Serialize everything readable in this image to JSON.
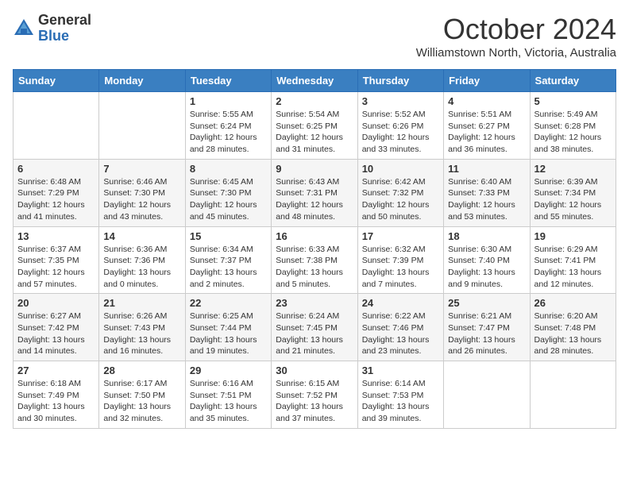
{
  "logo": {
    "general": "General",
    "blue": "Blue"
  },
  "header": {
    "month": "October 2024",
    "location": "Williamstown North, Victoria, Australia"
  },
  "weekdays": [
    "Sunday",
    "Monday",
    "Tuesday",
    "Wednesday",
    "Thursday",
    "Friday",
    "Saturday"
  ],
  "weeks": [
    [
      {
        "day": "",
        "info": ""
      },
      {
        "day": "",
        "info": ""
      },
      {
        "day": "1",
        "info": "Sunrise: 5:55 AM\nSunset: 6:24 PM\nDaylight: 12 hours and 28 minutes."
      },
      {
        "day": "2",
        "info": "Sunrise: 5:54 AM\nSunset: 6:25 PM\nDaylight: 12 hours and 31 minutes."
      },
      {
        "day": "3",
        "info": "Sunrise: 5:52 AM\nSunset: 6:26 PM\nDaylight: 12 hours and 33 minutes."
      },
      {
        "day": "4",
        "info": "Sunrise: 5:51 AM\nSunset: 6:27 PM\nDaylight: 12 hours and 36 minutes."
      },
      {
        "day": "5",
        "info": "Sunrise: 5:49 AM\nSunset: 6:28 PM\nDaylight: 12 hours and 38 minutes."
      }
    ],
    [
      {
        "day": "6",
        "info": "Sunrise: 6:48 AM\nSunset: 7:29 PM\nDaylight: 12 hours and 41 minutes."
      },
      {
        "day": "7",
        "info": "Sunrise: 6:46 AM\nSunset: 7:30 PM\nDaylight: 12 hours and 43 minutes."
      },
      {
        "day": "8",
        "info": "Sunrise: 6:45 AM\nSunset: 7:30 PM\nDaylight: 12 hours and 45 minutes."
      },
      {
        "day": "9",
        "info": "Sunrise: 6:43 AM\nSunset: 7:31 PM\nDaylight: 12 hours and 48 minutes."
      },
      {
        "day": "10",
        "info": "Sunrise: 6:42 AM\nSunset: 7:32 PM\nDaylight: 12 hours and 50 minutes."
      },
      {
        "day": "11",
        "info": "Sunrise: 6:40 AM\nSunset: 7:33 PM\nDaylight: 12 hours and 53 minutes."
      },
      {
        "day": "12",
        "info": "Sunrise: 6:39 AM\nSunset: 7:34 PM\nDaylight: 12 hours and 55 minutes."
      }
    ],
    [
      {
        "day": "13",
        "info": "Sunrise: 6:37 AM\nSunset: 7:35 PM\nDaylight: 12 hours and 57 minutes."
      },
      {
        "day": "14",
        "info": "Sunrise: 6:36 AM\nSunset: 7:36 PM\nDaylight: 13 hours and 0 minutes."
      },
      {
        "day": "15",
        "info": "Sunrise: 6:34 AM\nSunset: 7:37 PM\nDaylight: 13 hours and 2 minutes."
      },
      {
        "day": "16",
        "info": "Sunrise: 6:33 AM\nSunset: 7:38 PM\nDaylight: 13 hours and 5 minutes."
      },
      {
        "day": "17",
        "info": "Sunrise: 6:32 AM\nSunset: 7:39 PM\nDaylight: 13 hours and 7 minutes."
      },
      {
        "day": "18",
        "info": "Sunrise: 6:30 AM\nSunset: 7:40 PM\nDaylight: 13 hours and 9 minutes."
      },
      {
        "day": "19",
        "info": "Sunrise: 6:29 AM\nSunset: 7:41 PM\nDaylight: 13 hours and 12 minutes."
      }
    ],
    [
      {
        "day": "20",
        "info": "Sunrise: 6:27 AM\nSunset: 7:42 PM\nDaylight: 13 hours and 14 minutes."
      },
      {
        "day": "21",
        "info": "Sunrise: 6:26 AM\nSunset: 7:43 PM\nDaylight: 13 hours and 16 minutes."
      },
      {
        "day": "22",
        "info": "Sunrise: 6:25 AM\nSunset: 7:44 PM\nDaylight: 13 hours and 19 minutes."
      },
      {
        "day": "23",
        "info": "Sunrise: 6:24 AM\nSunset: 7:45 PM\nDaylight: 13 hours and 21 minutes."
      },
      {
        "day": "24",
        "info": "Sunrise: 6:22 AM\nSunset: 7:46 PM\nDaylight: 13 hours and 23 minutes."
      },
      {
        "day": "25",
        "info": "Sunrise: 6:21 AM\nSunset: 7:47 PM\nDaylight: 13 hours and 26 minutes."
      },
      {
        "day": "26",
        "info": "Sunrise: 6:20 AM\nSunset: 7:48 PM\nDaylight: 13 hours and 28 minutes."
      }
    ],
    [
      {
        "day": "27",
        "info": "Sunrise: 6:18 AM\nSunset: 7:49 PM\nDaylight: 13 hours and 30 minutes."
      },
      {
        "day": "28",
        "info": "Sunrise: 6:17 AM\nSunset: 7:50 PM\nDaylight: 13 hours and 32 minutes."
      },
      {
        "day": "29",
        "info": "Sunrise: 6:16 AM\nSunset: 7:51 PM\nDaylight: 13 hours and 35 minutes."
      },
      {
        "day": "30",
        "info": "Sunrise: 6:15 AM\nSunset: 7:52 PM\nDaylight: 13 hours and 37 minutes."
      },
      {
        "day": "31",
        "info": "Sunrise: 6:14 AM\nSunset: 7:53 PM\nDaylight: 13 hours and 39 minutes."
      },
      {
        "day": "",
        "info": ""
      },
      {
        "day": "",
        "info": ""
      }
    ]
  ]
}
